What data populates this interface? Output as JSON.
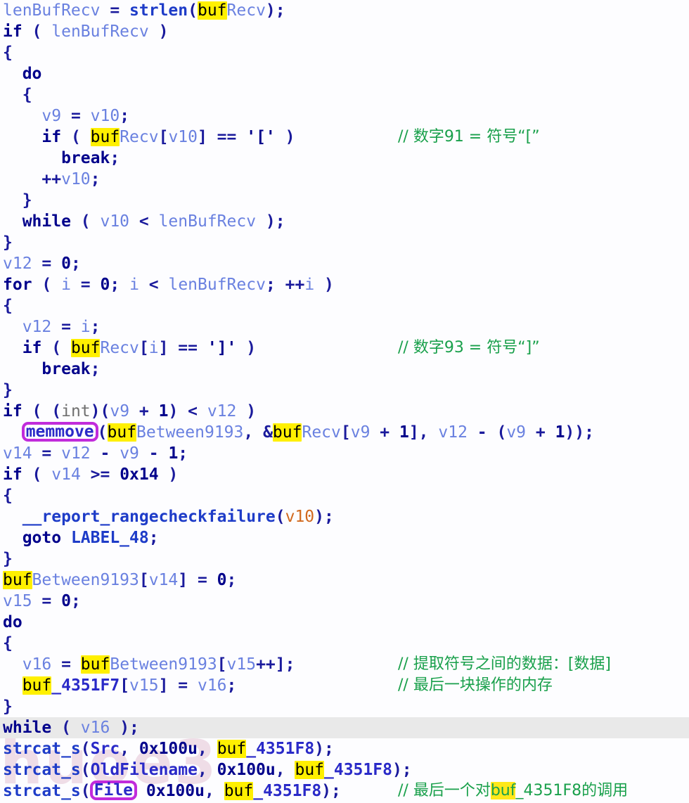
{
  "app": {
    "kind": "decompiler-pseudocode-view",
    "watermark_text": "huoe3"
  },
  "colors": {
    "background": "#fdfdff",
    "keyword": "#00008b",
    "local_variable": "#6a81e0",
    "function": "#1e3cc8",
    "global": "#2a2ac8",
    "comment": "#19a04b",
    "search_highlight": "#fff000",
    "box_border": "#c12bdb",
    "current_line": "#e9e9e9",
    "orange_var": "#d2691e"
  },
  "code": {
    "language": "c-pseudocode",
    "highlight_term": "buf",
    "boxed_terms": [
      "memmove",
      "File"
    ],
    "current_line_index": 34,
    "lines": [
      {
        "n": 1,
        "text": "lenBufRecv = strlen(bufRecv);"
      },
      {
        "n": 2,
        "text": "if ( lenBufRecv )"
      },
      {
        "n": 3,
        "text": "{"
      },
      {
        "n": 4,
        "text": "  do"
      },
      {
        "n": 5,
        "text": "  {"
      },
      {
        "n": 6,
        "text": "    v9 = v10;"
      },
      {
        "n": 7,
        "text": "    if ( bufRecv[v10] == '[' )",
        "comment": "// 数字91 = 符号“[”"
      },
      {
        "n": 8,
        "text": "      break;"
      },
      {
        "n": 9,
        "text": "    ++v10;"
      },
      {
        "n": 10,
        "text": "  }"
      },
      {
        "n": 11,
        "text": "  while ( v10 < lenBufRecv );"
      },
      {
        "n": 12,
        "text": "}"
      },
      {
        "n": 13,
        "text": "v12 = 0;"
      },
      {
        "n": 14,
        "text": "for ( i = 0; i < lenBufRecv; ++i )"
      },
      {
        "n": 15,
        "text": "{"
      },
      {
        "n": 16,
        "text": "  v12 = i;"
      },
      {
        "n": 17,
        "text": "  if ( bufRecv[i] == ']' )",
        "comment": "// 数字93 = 符号“]”"
      },
      {
        "n": 18,
        "text": "    break;"
      },
      {
        "n": 19,
        "text": "}"
      },
      {
        "n": 20,
        "text": "if ( (int)(v9 + 1) < v12 )"
      },
      {
        "n": 21,
        "text": "  memmove(bufBetween9193, &bufRecv[v9 + 1], v12 - (v9 + 1));"
      },
      {
        "n": 22,
        "text": "v14 = v12 - v9 - 1;"
      },
      {
        "n": 23,
        "text": "if ( v14 >= 0x14 )"
      },
      {
        "n": 24,
        "text": "{"
      },
      {
        "n": 25,
        "text": "  __report_rangecheckfailure(v10);"
      },
      {
        "n": 26,
        "text": "  goto LABEL_48;"
      },
      {
        "n": 27,
        "text": "}"
      },
      {
        "n": 28,
        "text": "bufBetween9193[v14] = 0;"
      },
      {
        "n": 29,
        "text": "v15 = 0;"
      },
      {
        "n": 30,
        "text": "do"
      },
      {
        "n": 31,
        "text": "{"
      },
      {
        "n": 32,
        "text": "  v16 = bufBetween9193[v15++];",
        "comment": "// 提取符号之间的数据：[数据]"
      },
      {
        "n": 33,
        "text": "  buf_4351F7[v15] = v16;",
        "comment": "// 最后一块操作的内存"
      },
      {
        "n": 34,
        "text": "}"
      },
      {
        "n": 35,
        "text": "while ( v16 );",
        "current": true
      },
      {
        "n": 36,
        "text": "strcat_s(Src, 0x100u, buf_4351F8);"
      },
      {
        "n": 37,
        "text": "strcat_s(OldFilename, 0x100u, buf_4351F8);"
      },
      {
        "n": 38,
        "text": "strcat_s(File, 0x100u, buf_4351F8);",
        "comment": "// 最后一个对buf_4351F8的调用"
      }
    ]
  },
  "comments": {
    "c7": "// 数字91 = 符号“[”",
    "c17": "// 数字93 = 符号“]”",
    "c32": "// 提取符号之间的数据：[数据]",
    "c33": "// 最后一块操作的内存",
    "c38_pre": "// 最后一个对",
    "c38_hl": "buf",
    "c38_post": "_4351F8的调用"
  },
  "identifiers": {
    "lenBufRecv": "lenBufRecv",
    "bufRecv": "bufRecv",
    "bufBetween9193": "bufBetween9193",
    "buf_4351F7": "buf_4351F7",
    "buf_4351F8": "buf_4351F8",
    "strlen": "strlen",
    "memmove": "memmove",
    "strcat_s": "strcat_s",
    "report_rangecheckfailure": "__report_rangecheckfailure",
    "Src": "Src",
    "OldFilename": "OldFilename",
    "File": "File",
    "LABEL_48": "LABEL_48"
  }
}
